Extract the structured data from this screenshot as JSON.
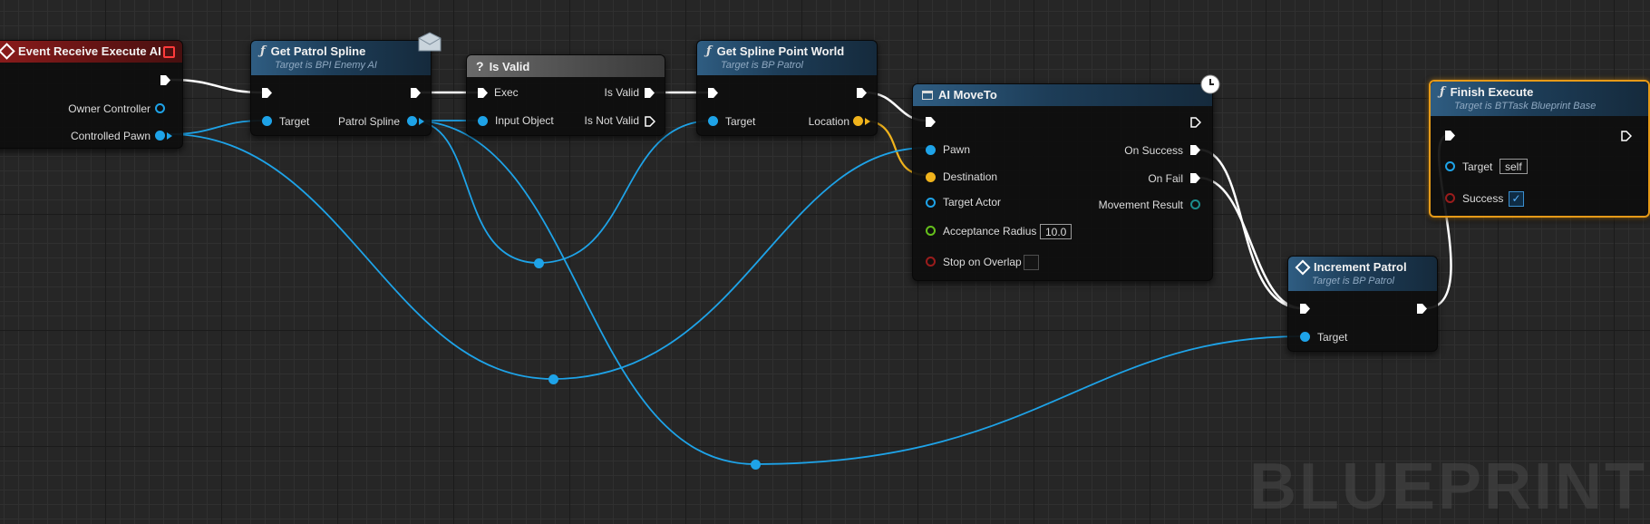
{
  "nodes": {
    "event": {
      "title": "Event Receive Execute AI",
      "owner_controller": "Owner Controller",
      "controlled_pawn": "Controlled Pawn"
    },
    "get_patrol_spline": {
      "title": "Get Patrol Spline",
      "subtitle": "Target is BPI Enemy AI",
      "target": "Target",
      "patrol_spline": "Patrol Spline"
    },
    "is_valid": {
      "title": "Is Valid",
      "exec": "Exec",
      "input_object": "Input Object",
      "is_valid": "Is Valid",
      "is_not_valid": "Is Not Valid"
    },
    "get_spline_point": {
      "title": "Get Spline Point World",
      "subtitle": "Target is BP Patrol",
      "target": "Target",
      "location": "Location"
    },
    "ai_moveto": {
      "title": "AI MoveTo",
      "pawn": "Pawn",
      "destination": "Destination",
      "target_actor": "Target Actor",
      "acceptance_radius": "Acceptance Radius",
      "acceptance_radius_value": "10.0",
      "stop_on_overlap": "Stop on Overlap",
      "on_success": "On Success",
      "on_fail": "On Fail",
      "movement_result": "Movement Result"
    },
    "increment_patrol": {
      "title": "Increment Patrol",
      "subtitle": "Target is BP Patrol",
      "target": "Target"
    },
    "finish_execute": {
      "title": "Finish Execute",
      "subtitle": "Target is BTTask Blueprint Base",
      "target": "Target",
      "target_value": "self",
      "success": "Success",
      "success_checked": true
    }
  },
  "watermark": "BLUEPRINT",
  "colors": {
    "exec": "#ffffff",
    "object": "#1ea3e8",
    "vector": "#f0b31c",
    "struct_teal": "#1c8c8c",
    "float": "#65c01c",
    "bool": "#9a1c1c",
    "selection": "#e69a18"
  }
}
